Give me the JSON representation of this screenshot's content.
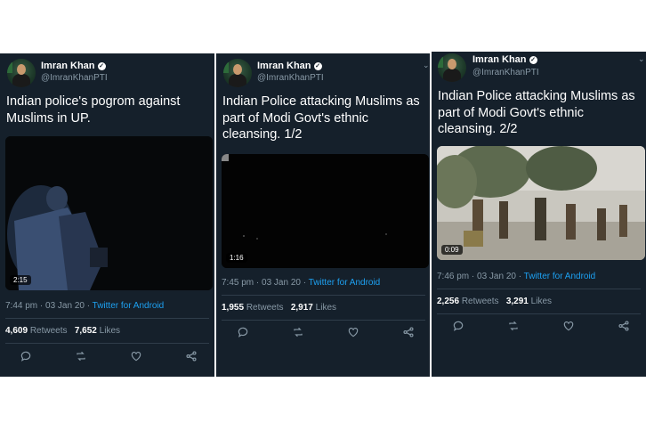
{
  "tweets": [
    {
      "author": "Imran Khan",
      "handle": "@ImranKhanPTI",
      "text": "Indian police's pogrom against Muslims in UP.",
      "duration": "2:15",
      "time": "7:44 pm · 03 Jan 20 · ",
      "source": "Twitter for Android",
      "retweets": "4,609",
      "retweets_label": "Retweets",
      "likes": "7,652",
      "likes_label": "Likes"
    },
    {
      "author": "Imran Khan",
      "handle": "@ImranKhanPTI",
      "text": "Indian Police attacking Muslims as part of Modi Govt's ethnic cleansing. 1/2",
      "duration": "1:16",
      "time": "7:45 pm · 03 Jan 20 · ",
      "source": "Twitter for Android",
      "retweets": "1,955",
      "retweets_label": "Retweets",
      "likes": "2,917",
      "likes_label": "Likes"
    },
    {
      "author": "Imran Khan",
      "handle": "@ImranKhanPTI",
      "text": "Indian Police attacking Muslims as part of Modi Govt's ethnic cleansing. 2/2",
      "duration": "0:09",
      "time": "7:46 pm · 03 Jan 20 · ",
      "source": "Twitter for Android",
      "retweets": "2,256",
      "retweets_label": "Retweets",
      "likes": "3,291",
      "likes_label": "Likes"
    }
  ],
  "colors": {
    "background": "#15202b",
    "accent": "#1da1f2",
    "muted": "#8899a6"
  },
  "icons": [
    "reply-icon",
    "retweet-icon",
    "like-icon",
    "share-icon",
    "verified-badge-icon",
    "chevron-down-icon"
  ]
}
